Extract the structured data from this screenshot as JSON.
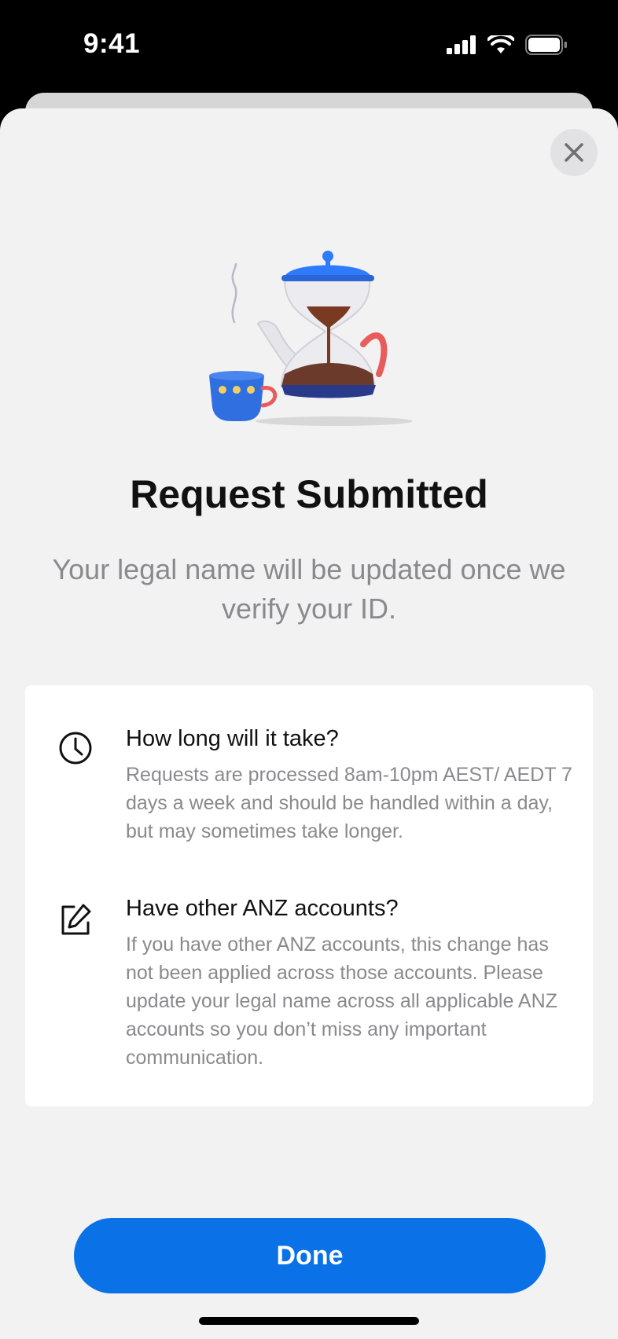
{
  "status_bar": {
    "time": "9:41"
  },
  "header": {
    "close_icon": "close-icon"
  },
  "main": {
    "title": "Request Submitted",
    "subtitle": "Your legal name will be updated once we verify your ID."
  },
  "info": [
    {
      "icon": "clock-icon",
      "title": "How long will it take?",
      "text": "Requests are processed 8am-10pm AEST/ AEDT 7 days a week and should be handled within a day, but may sometimes take longer."
    },
    {
      "icon": "edit-icon",
      "title": "Have other ANZ accounts?",
      "text": "If you have other ANZ accounts, this change has not been applied across those accounts. Please update your legal name across all applicable ANZ accounts so you don’t miss any important communication."
    }
  ],
  "footer": {
    "done_label": "Done"
  },
  "colors": {
    "accent": "#0a72e6",
    "background": "#f2f2f2",
    "secondary_text": "#8a8a8e"
  }
}
